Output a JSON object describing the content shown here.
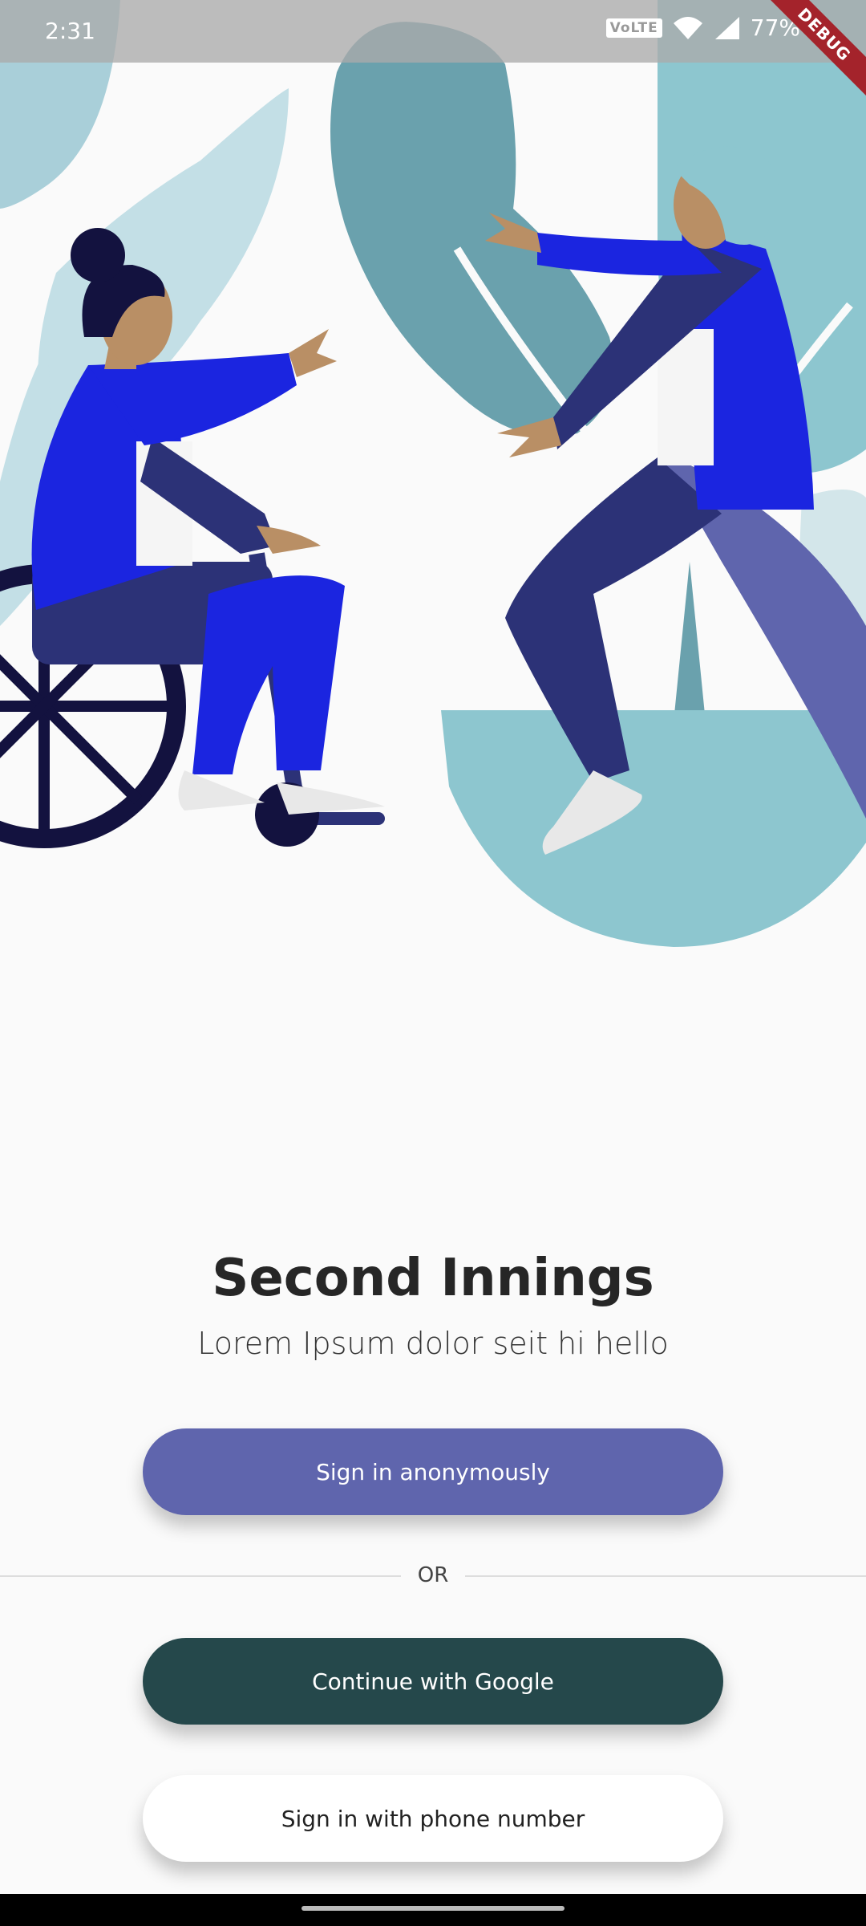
{
  "status_bar": {
    "time": "2:31",
    "network_badge": "VoLTE",
    "battery": "77%",
    "icons": [
      "wifi-icon",
      "signal-icon",
      "battery-charging-icon"
    ]
  },
  "debug_banner": "DEBUG",
  "welcome": {
    "title": "Second Innings",
    "subtitle": "Lorem Ipsum dolor seit hi hello"
  },
  "auth": {
    "anonymous_label": "Sign in anonymously",
    "divider_label": "OR",
    "google_label": "Continue with Google",
    "phone_label": "Sign in with phone number"
  },
  "colors": {
    "anonymous_button": "#5f65ad",
    "google_button": "#25484b",
    "phone_button": "#ffffff",
    "background": "#fafafa"
  }
}
